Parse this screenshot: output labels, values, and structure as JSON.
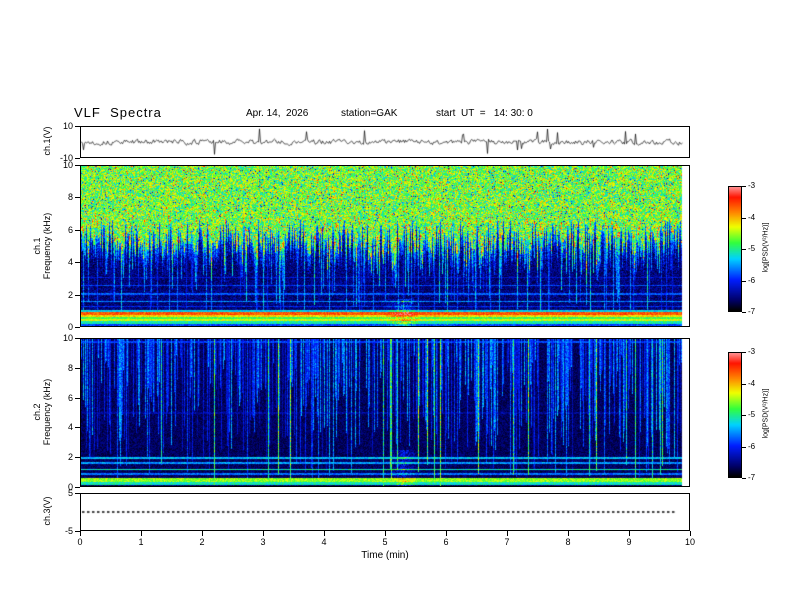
{
  "header": {
    "title": "VLF  Spectra",
    "date": "Apr. 14,  2026",
    "station": "station=GAK",
    "start_ut": "start  UT  =   14: 30: 0"
  },
  "time_axis": {
    "label": "Time  (min)",
    "min": 0,
    "max": 10,
    "ticks": [
      0,
      1,
      2,
      3,
      4,
      5,
      6,
      7,
      8,
      9,
      10
    ],
    "data_end_min": 9.8
  },
  "colorbar": {
    "label": "log[PSD(V²/Hz)]",
    "min": -7,
    "max": -3,
    "ticks": [
      -3,
      -4,
      -5,
      -6,
      -7
    ]
  },
  "chart_data": [
    {
      "type": "line",
      "name": "ch1-waveform",
      "channel": "ch.1",
      "ylabel": "ch.1(V)",
      "ylim": [
        -10,
        10
      ],
      "yticks": [
        10,
        -10
      ],
      "xlim": [
        0,
        10
      ],
      "data_end_frac": 0.99,
      "seed": 13,
      "noise_amp_v": 1.4,
      "spike_amp_v": 9,
      "spike_prob": 0.022,
      "description": "Broadband noise near 0 V with sparse impulsive spikes up to about ±9 V"
    },
    {
      "type": "heatmap",
      "name": "ch1-spectrogram",
      "channel": "ch.1",
      "ylabel": "Frequency  (kHz)",
      "ylim": [
        0,
        10
      ],
      "yticks": [
        10,
        8,
        6,
        4,
        2,
        0
      ],
      "xlim": [
        0,
        10
      ],
      "zlabel": "log[PSD(V²/Hz)]",
      "zlim": [
        -7,
        -3
      ],
      "data_end_frac": 0.988,
      "seed": 42,
      "background_psd": -6.85,
      "background_jitter": 0.55,
      "hiss_edge_khz": 5.6,
      "hiss_psd": -4.85,
      "hiss_jitter": 1.35,
      "red_burst_prob": 0.02,
      "streak_rate": 0.38,
      "streak_boost": [
        0.4,
        1.7
      ],
      "streak_depth": [
        0.45,
        1.0
      ],
      "strong_streak_prob": 0,
      "hlines": [
        {
          "f": 3.05,
          "psd": -6.2,
          "w": 0.04
        },
        {
          "f": 2.55,
          "psd": -5.9,
          "w": 0.04
        },
        {
          "f": 2.05,
          "psd": -5.8,
          "w": 0.05
        },
        {
          "f": 1.55,
          "psd": -5.6,
          "w": 0.05
        },
        {
          "f": 1.25,
          "psd": -6.0,
          "w": 0.04
        }
      ],
      "bands": [
        {
          "f": [
            0.88,
            1.02
          ],
          "psd": -5.3
        },
        {
          "f": [
            0.72,
            0.88
          ],
          "psd": -3.6
        },
        {
          "f": [
            0.58,
            0.72
          ],
          "psd": -4.1
        },
        {
          "f": [
            0.45,
            0.58
          ],
          "psd": -4.8
        },
        {
          "f": [
            0.32,
            0.45
          ],
          "psd": -4.35
        },
        {
          "f": [
            0.18,
            0.32
          ],
          "psd": -5.1
        },
        {
          "f": [
            0.05,
            0.18
          ],
          "psd": -5.9
        }
      ],
      "event": {
        "t": 5.3,
        "w": 0.3,
        "fmax": 1.7,
        "boost": 1.1
      },
      "description": "Strong VLF hiss above ~5-6 kHz (green-yellow speckle with red bursts), impulsive vertical streaks below, narrow power-line harmonics near 1-3 kHz and intense colored bands below 1 kHz"
    },
    {
      "type": "heatmap",
      "name": "ch2-spectrogram",
      "channel": "ch.2",
      "ylabel": "Frequency  (kHz)",
      "ylim": [
        0,
        10
      ],
      "yticks": [
        10,
        8,
        6,
        4,
        2,
        0
      ],
      "xlim": [
        0,
        10
      ],
      "zlabel": "log[PSD(V²/Hz)]",
      "zlim": [
        -7,
        -3
      ],
      "data_end_frac": 0.988,
      "seed": 77,
      "background_psd": -6.88,
      "background_jitter": 0.38,
      "hiss_edge_khz": null,
      "hiss_psd": null,
      "hiss_jitter": 0,
      "red_burst_prob": 0,
      "streak_rate": 0.6,
      "streak_boost": [
        0.35,
        1.5
      ],
      "streak_depth": [
        0.1,
        0.95
      ],
      "strong_streak_prob": 0.055,
      "hlines": [
        {
          "f": 9.85,
          "psd": -5.9,
          "w": 0.07
        },
        {
          "f": 5.0,
          "psd": -6.45,
          "w": 0.05
        },
        {
          "f": 1.95,
          "psd": -5.4,
          "w": 0.05
        },
        {
          "f": 1.6,
          "psd": -5.55,
          "w": 0.05
        },
        {
          "f": 1.15,
          "psd": -5.1,
          "w": 0.06
        },
        {
          "f": 0.85,
          "psd": -5.7,
          "w": 0.05
        }
      ],
      "bands": [
        {
          "f": [
            0.3,
            0.55
          ],
          "psd": -4.55
        },
        {
          "f": [
            0.1,
            0.3
          ],
          "psd": -5.15
        }
      ],
      "event": {
        "t": 5.3,
        "w": 0.25,
        "fmax": 2.5,
        "boost": 0.9
      },
      "description": "Mostly weak dark background with dense impulsive vertical streaks descending from the top, narrow lines near 1-2 kHz and a green band below 0.5 kHz"
    },
    {
      "type": "line",
      "name": "ch3-trace",
      "channel": "ch.3",
      "ylabel": "ch.3(V)",
      "ylim": [
        -5,
        5
      ],
      "yticks": [
        5,
        -5
      ],
      "xlim": [
        0,
        10
      ],
      "data_end_frac": 0.98,
      "constant_value_v": 0,
      "line_style": "dotted",
      "description": "Flat trace at 0 V for the whole interval"
    }
  ]
}
